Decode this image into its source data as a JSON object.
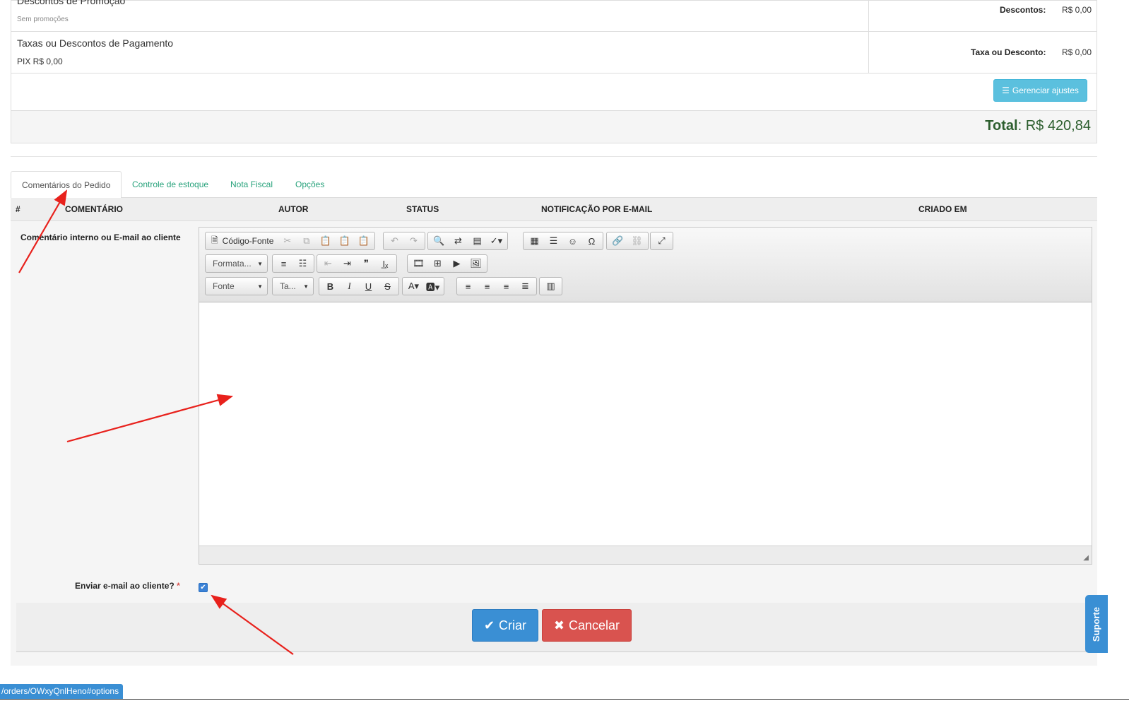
{
  "summary": {
    "promo_title": "Descontos de Promoção",
    "promo_sub": "Sem promoções",
    "discounts_label": "Descontos:",
    "discounts_value": "R$ 0,00",
    "payment_title": "Taxas ou Descontos de Pagamento",
    "payment_sub": "PIX R$ 0,00",
    "fee_label": "Taxa ou Desconto:",
    "fee_value": "R$ 0,00",
    "manage_button": "Gerenciar ajustes",
    "total_label": "Total",
    "total_value": ": R$ 420,84"
  },
  "tabs": [
    {
      "label": "Comentários do Pedido",
      "active": true
    },
    {
      "label": "Controle de estoque",
      "active": false
    },
    {
      "label": "Nota Fiscal",
      "active": false
    },
    {
      "label": "Opções",
      "active": false
    }
  ],
  "table": {
    "headers": [
      "#",
      "COMENTÁRIO",
      "AUTOR",
      "STATUS",
      "NOTIFICAÇÃO POR E-MAIL",
      "CRIADO EM"
    ]
  },
  "form": {
    "comment_label": "Comentário interno ou E-mail ao cliente",
    "send_email_label": "Enviar e-mail ao cliente?",
    "required_mark": "*",
    "send_email_checked": true
  },
  "editor": {
    "source_label": "Código-Fonte",
    "format_combo": "Formata...",
    "font_combo": "Fonte",
    "size_combo": "Ta..."
  },
  "actions": {
    "create_label": "Criar",
    "cancel_label": "Cancelar"
  },
  "support_label": "Suporte",
  "status_url": "/orders/OWxyQnlHeno#options",
  "colors": {
    "accent": "#27a27b",
    "primary": "#3a8fd4",
    "danger": "#d9534f",
    "info": "#5bc0de",
    "total": "#2c5e2e",
    "annotation": "#e8211c"
  }
}
